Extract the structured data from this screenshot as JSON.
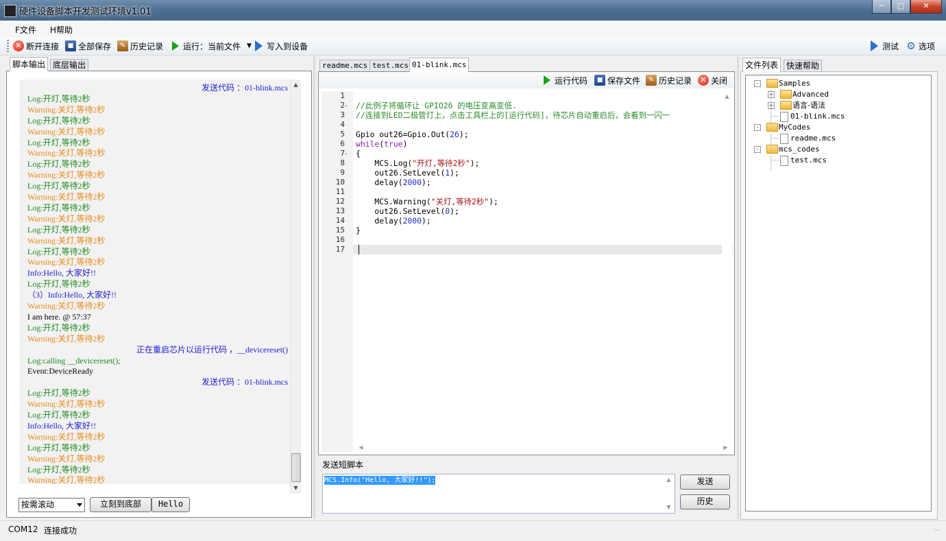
{
  "window": {
    "title": "硬件设备脚本开发测试环境v1.01"
  },
  "menu": {
    "file": "F文件",
    "help": "H帮助"
  },
  "toolbar": {
    "disconnect": "断开连接",
    "save_all": "全部保存",
    "history": "历史记录",
    "run": "运行：当前文件",
    "write_device": "写入到设备",
    "test": "测试",
    "options": "选项"
  },
  "left": {
    "tabs": [
      "脚本输出",
      "底层输出"
    ],
    "log": [
      {
        "t": "发送代码 ：01-blink.mcs",
        "c": "send",
        "r": true
      },
      {
        "t": "Log:开灯,等待2秒",
        "c": "log"
      },
      {
        "t": "Warning:关灯,等待2秒",
        "c": "warn"
      },
      {
        "t": "Log:开灯,等待2秒",
        "c": "log"
      },
      {
        "t": "Warning:关灯,等待2秒",
        "c": "warn"
      },
      {
        "t": "Log:开灯,等待2秒",
        "c": "log"
      },
      {
        "t": "Warning:关灯,等待2秒",
        "c": "warn"
      },
      {
        "t": "Log:开灯,等待2秒",
        "c": "log"
      },
      {
        "t": "Warning:关灯,等待2秒",
        "c": "warn"
      },
      {
        "t": "Log:开灯,等待2秒",
        "c": "log"
      },
      {
        "t": "Warning:关灯,等待2秒",
        "c": "warn"
      },
      {
        "t": "Log:开灯,等待2秒",
        "c": "log"
      },
      {
        "t": "Warning:关灯,等待2秒",
        "c": "warn"
      },
      {
        "t": "Log:开灯,等待2秒",
        "c": "log"
      },
      {
        "t": "Warning:关灯,等待2秒",
        "c": "warn"
      },
      {
        "t": "Log:开灯,等待2秒",
        "c": "log"
      },
      {
        "t": "Warning:关灯,等待2秒",
        "c": "warn"
      },
      {
        "t": "Info:Hello, 大家好!!",
        "c": "info"
      },
      {
        "t": "Log:开灯,等待2秒",
        "c": "log"
      },
      {
        "t": "（3）Info:Hello, 大家好!!",
        "c": "info"
      },
      {
        "t": "Warning:关灯,等待2秒",
        "c": "warn"
      },
      {
        "t": "I am here. @ 57:37",
        "c": "plain"
      },
      {
        "t": "Log:开灯,等待2秒",
        "c": "log"
      },
      {
        "t": "Warning:关灯,等待2秒",
        "c": "warn"
      },
      {
        "t": "正在重启芯片以运行代码 ，__devicereset()",
        "c": "send",
        "r": true
      },
      {
        "t": "Log:calling __devicereset();",
        "c": "log"
      },
      {
        "t": "Event:DeviceReady",
        "c": "plain"
      },
      {
        "t": "发送代码 ：01-blink.mcs",
        "c": "send",
        "r": true
      },
      {
        "t": "Log:开灯,等待2秒",
        "c": "log"
      },
      {
        "t": "Warning:关灯,等待2秒",
        "c": "warn"
      },
      {
        "t": "Log:开灯,等待2秒",
        "c": "log"
      },
      {
        "t": "Info:Hello, 大家好!!",
        "c": "info"
      },
      {
        "t": "Warning:关灯,等待2秒",
        "c": "warn"
      },
      {
        "t": "Log:开灯,等待2秒",
        "c": "log"
      },
      {
        "t": "Warning:关灯,等待2秒",
        "c": "warn"
      },
      {
        "t": "Log:开灯,等待2秒",
        "c": "log"
      },
      {
        "t": "Warning:关灯,等待2秒",
        "c": "warn"
      }
    ],
    "scroll_mode": "按需滚动",
    "to_bottom": "立刻到底部",
    "hello_btn": "Hello"
  },
  "editor": {
    "tabs": [
      "readme.mcs",
      "test.mcs",
      "01-blink.mcs"
    ],
    "active_tab": 2,
    "toolbar": {
      "run": "运行代码",
      "save": "保存文件",
      "history": "历史记录",
      "close": "关闭"
    },
    "lines": [
      [],
      [
        [
          "com",
          "//此例子将循环让 GPIO26 的电压变高变低."
        ]
      ],
      [
        [
          "com",
          "//连接到LED二极管灯上，点击工具栏上的[运行代码]，待芯片自动重启后，会看到一闪一"
        ]
      ],
      [],
      [
        [
          "pl",
          "Gpio out26=Gpio.Out("
        ],
        [
          "num",
          "26"
        ],
        [
          "pl",
          ");"
        ]
      ],
      [
        [
          "kw",
          "while"
        ],
        [
          "pl",
          "("
        ],
        [
          "kw",
          "true"
        ],
        [
          "pl",
          ")"
        ]
      ],
      [
        [
          "pl",
          "{"
        ]
      ],
      [
        [
          "pl",
          "    MCS.Log("
        ],
        [
          "str",
          "\"开灯,等待2秒\""
        ],
        [
          "pl",
          ");"
        ]
      ],
      [
        [
          "pl",
          "    out26.SetLevel("
        ],
        [
          "num",
          "1"
        ],
        [
          "pl",
          ");"
        ]
      ],
      [
        [
          "pl",
          "    delay("
        ],
        [
          "num",
          "2000"
        ],
        [
          "pl",
          ");"
        ]
      ],
      [],
      [
        [
          "pl",
          "    MCS.Warning("
        ],
        [
          "str",
          "\"关灯,等待2秒\""
        ],
        [
          "pl",
          ");"
        ]
      ],
      [
        [
          "pl",
          "    out26.SetLevel("
        ],
        [
          "num",
          "0"
        ],
        [
          "pl",
          ");"
        ]
      ],
      [
        [
          "pl",
          "    delay("
        ],
        [
          "num",
          "2000"
        ],
        [
          "pl",
          ");"
        ]
      ],
      [
        [
          "pl",
          "}"
        ]
      ],
      [],
      []
    ],
    "line_numbers": [
      "1",
      "2",
      "3",
      "4",
      "5",
      "6",
      "7",
      "8",
      "9",
      "10",
      "11",
      "12",
      "13",
      "14",
      "15",
      "16",
      "17"
    ],
    "fold_markers": {
      "1": "-",
      "6": "-"
    }
  },
  "send": {
    "label": "发送短脚本",
    "text": "MCS.Info(\"Hello, 大家好!!\");",
    "send_btn": "发送",
    "history_btn": "历史"
  },
  "right": {
    "tabs": [
      "文件列表",
      "快速帮助"
    ],
    "tree": [
      {
        "label": "Samples",
        "type": "folder",
        "level": 0,
        "exp": "-"
      },
      {
        "label": "Advanced",
        "type": "folder",
        "level": 1,
        "exp": "+"
      },
      {
        "label": "语言-语法",
        "type": "folder",
        "level": 1,
        "exp": "+"
      },
      {
        "label": "01-blink.mcs",
        "type": "file",
        "level": 1
      },
      {
        "label": "MyCodes",
        "type": "folder",
        "level": 0,
        "exp": "-"
      },
      {
        "label": "readme.mcs",
        "type": "file",
        "level": 1
      },
      {
        "label": "mcs_codes",
        "type": "folder",
        "level": 0,
        "exp": "-"
      },
      {
        "label": "test.mcs",
        "type": "file",
        "level": 1
      }
    ]
  },
  "status": {
    "port": "COM12",
    "state": "连接成功"
  }
}
